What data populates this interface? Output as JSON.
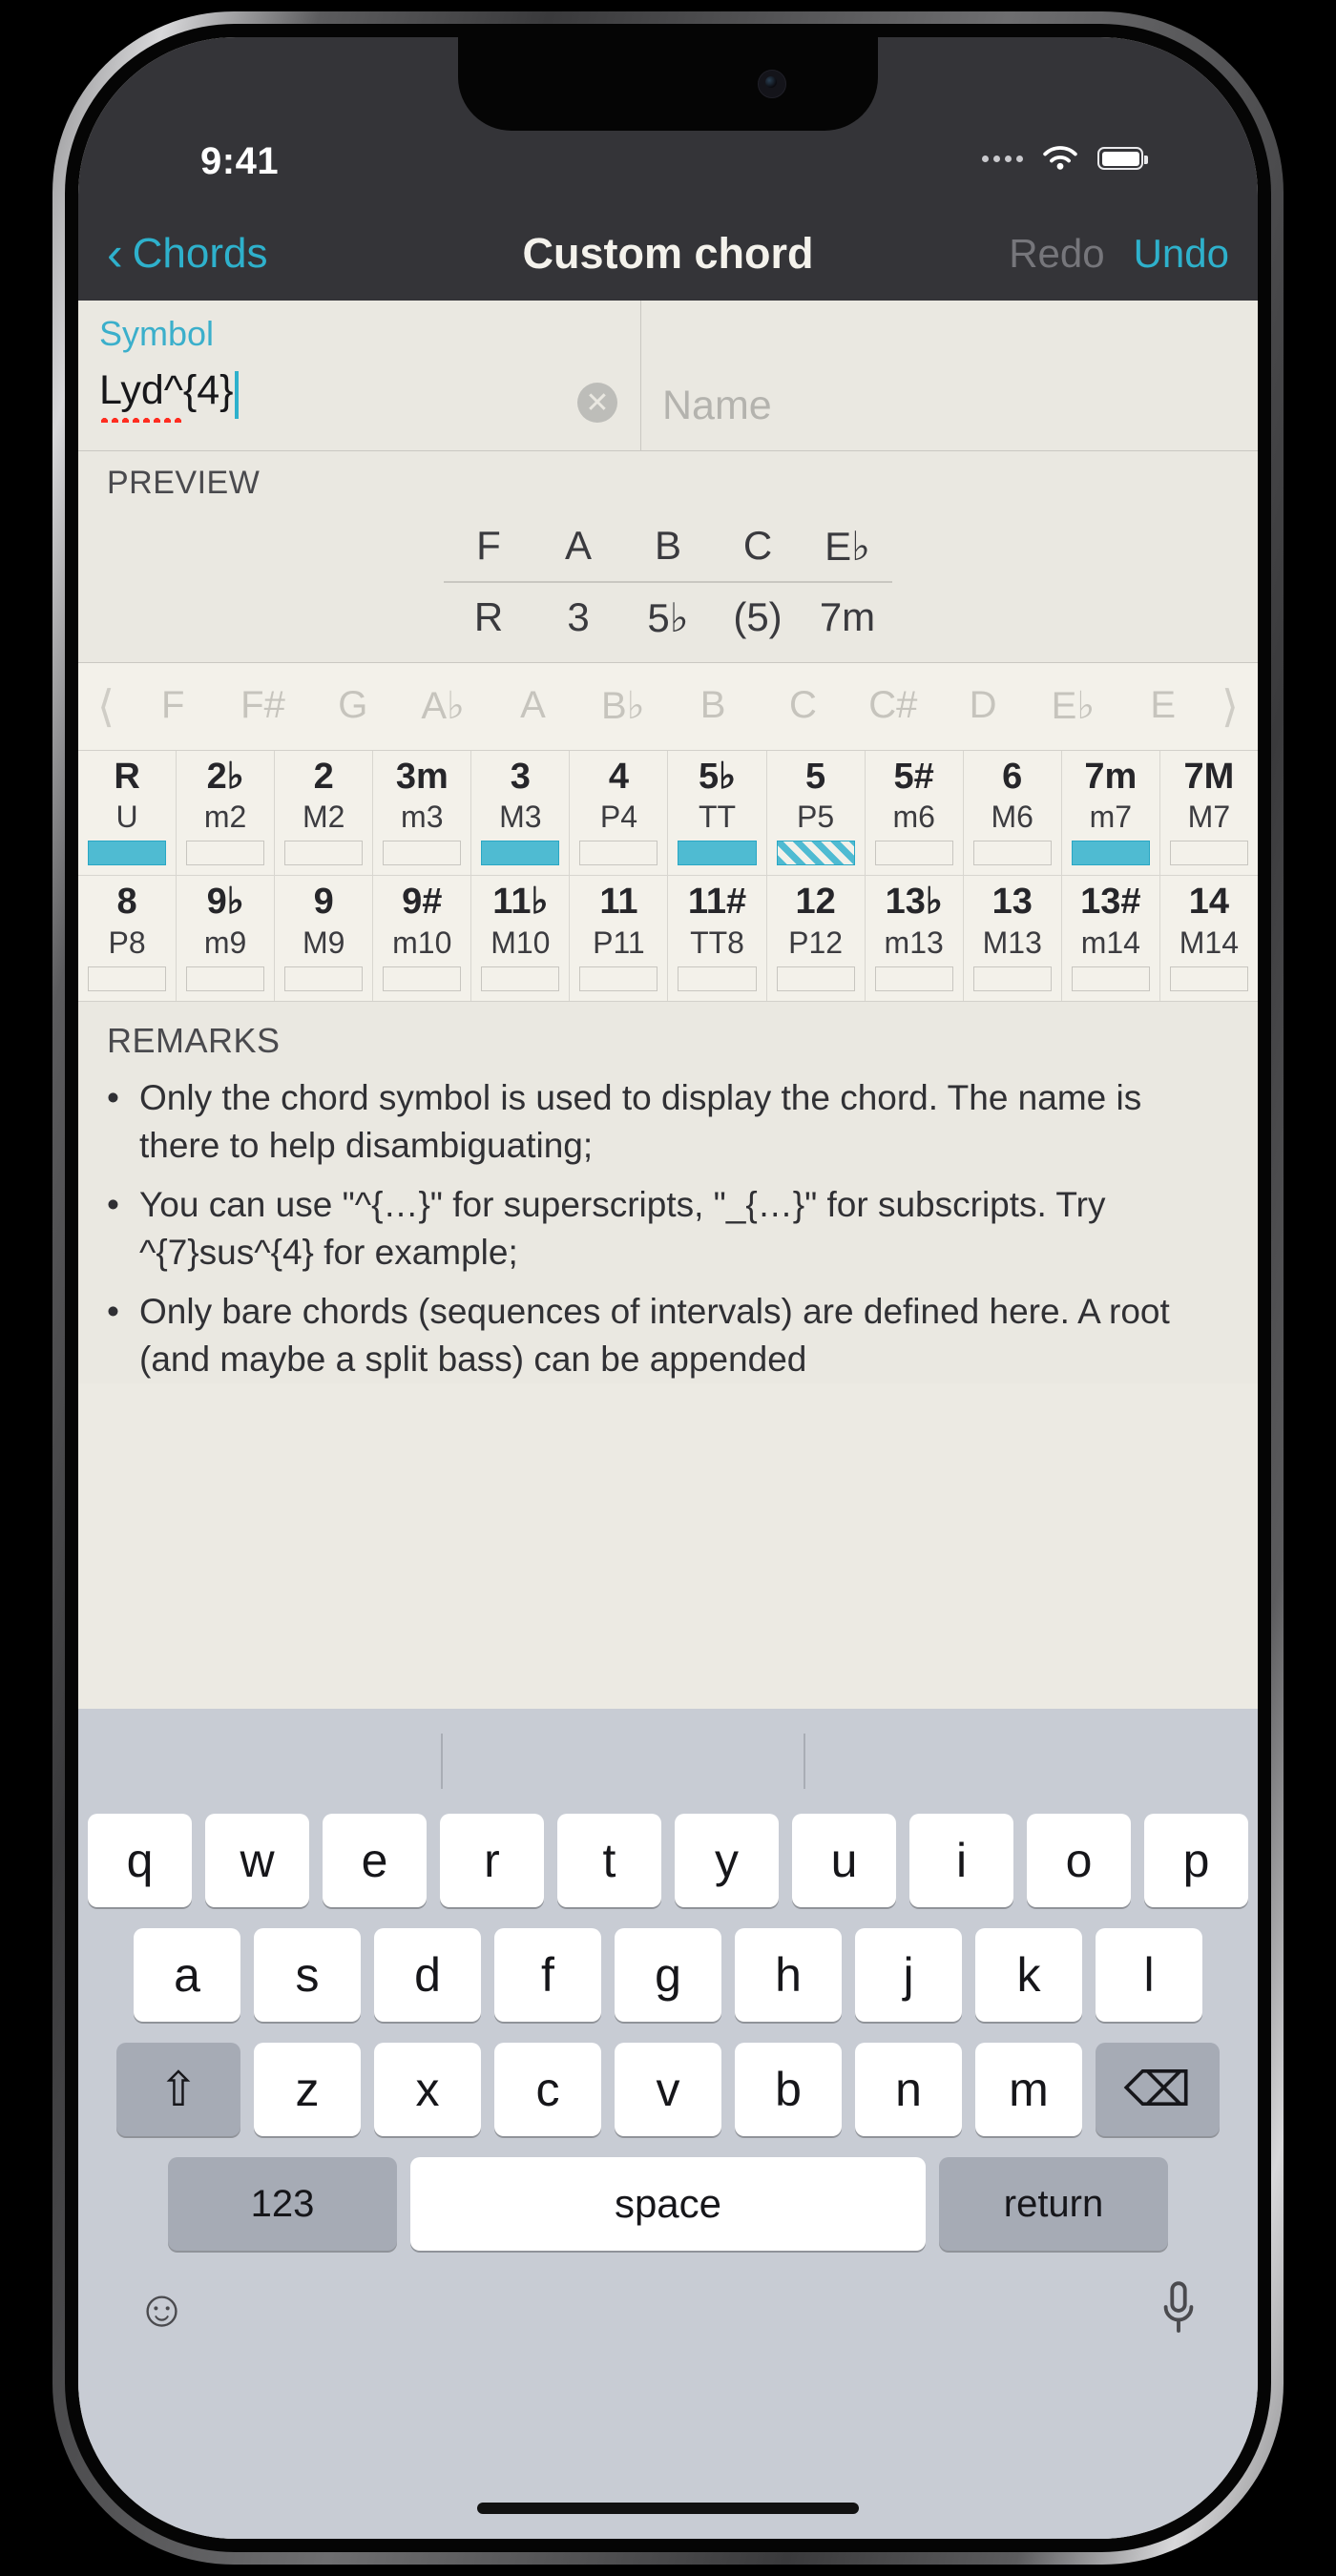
{
  "status_bar": {
    "time": "9:41",
    "signal_icon": "signal-dots",
    "wifi_icon": "wifi-icon",
    "battery_icon": "battery-full-icon"
  },
  "nav": {
    "back_chevron": "‹",
    "back_label": "Chords",
    "title": "Custom chord",
    "redo_label": "Redo",
    "undo_label": "Undo",
    "redo_enabled": "false",
    "undo_enabled": "true",
    "accent_color": "#2EB1CC",
    "disabled_color": "#76767b"
  },
  "fields": {
    "symbol_label": "Symbol",
    "symbol_value": "Lyd^{4}",
    "clear_icon": "✕",
    "name_placeholder": "Name"
  },
  "preview": {
    "title": "PREVIEW",
    "notes": [
      "F",
      "A",
      "B",
      "C",
      "E♭"
    ],
    "degrees": [
      "R",
      "3",
      "5♭",
      "(5)",
      "7m"
    ]
  },
  "root_picker": {
    "left_arrow": "⟨",
    "right_arrow": "⟩",
    "roots": [
      "F",
      "F#",
      "G",
      "A♭",
      "A",
      "B♭",
      "B",
      "C",
      "C#",
      "D",
      "E♭",
      "E"
    ]
  },
  "intervals": {
    "row1": [
      {
        "degree": "R",
        "name": "U",
        "state": "on"
      },
      {
        "degree": "2♭",
        "name": "m2",
        "state": "off"
      },
      {
        "degree": "2",
        "name": "M2",
        "state": "off"
      },
      {
        "degree": "3m",
        "name": "m3",
        "state": "off"
      },
      {
        "degree": "3",
        "name": "M3",
        "state": "on"
      },
      {
        "degree": "4",
        "name": "P4",
        "state": "off"
      },
      {
        "degree": "5♭",
        "name": "TT",
        "state": "on"
      },
      {
        "degree": "5",
        "name": "P5",
        "state": "opt"
      },
      {
        "degree": "5#",
        "name": "m6",
        "state": "off"
      },
      {
        "degree": "6",
        "name": "M6",
        "state": "off"
      },
      {
        "degree": "7m",
        "name": "m7",
        "state": "on"
      },
      {
        "degree": "7M",
        "name": "M7",
        "state": "off"
      }
    ],
    "row2": [
      {
        "degree": "8",
        "name": "P8",
        "state": "off"
      },
      {
        "degree": "9♭",
        "name": "m9",
        "state": "off"
      },
      {
        "degree": "9",
        "name": "M9",
        "state": "off"
      },
      {
        "degree": "9#",
        "name": "m10",
        "state": "off"
      },
      {
        "degree": "11♭",
        "name": "M10",
        "state": "off"
      },
      {
        "degree": "11",
        "name": "P11",
        "state": "off"
      },
      {
        "degree": "11#",
        "name": "TT8",
        "state": "off"
      },
      {
        "degree": "12",
        "name": "P12",
        "state": "off"
      },
      {
        "degree": "13♭",
        "name": "m13",
        "state": "off"
      },
      {
        "degree": "13",
        "name": "M13",
        "state": "off"
      },
      {
        "degree": "13#",
        "name": "m14",
        "state": "off"
      },
      {
        "degree": "14",
        "name": "M14",
        "state": "off"
      }
    ]
  },
  "remarks": {
    "title": "REMARKS",
    "items": [
      "Only the chord symbol is used to display the chord. The name is there to help disambiguating;",
      "You can use \"^{…}\" for superscripts, \"_{…}\" for subscripts. Try ^{7}sus^{4} for example;",
      "Only bare chords (sequences of intervals) are defined here. A root (and maybe a split bass) can be appended"
    ]
  },
  "keyboard": {
    "row1": [
      "q",
      "w",
      "e",
      "r",
      "t",
      "y",
      "u",
      "i",
      "o",
      "p"
    ],
    "row2": [
      "a",
      "s",
      "d",
      "f",
      "g",
      "h",
      "j",
      "k",
      "l"
    ],
    "row3": [
      "z",
      "x",
      "c",
      "v",
      "b",
      "n",
      "m"
    ],
    "shift_icon": "⇧",
    "backspace_icon": "⌫",
    "numbers_label": "123",
    "space_label": "space",
    "return_label": "return",
    "emoji_icon": "☺",
    "mic_icon": "microphone-icon"
  }
}
